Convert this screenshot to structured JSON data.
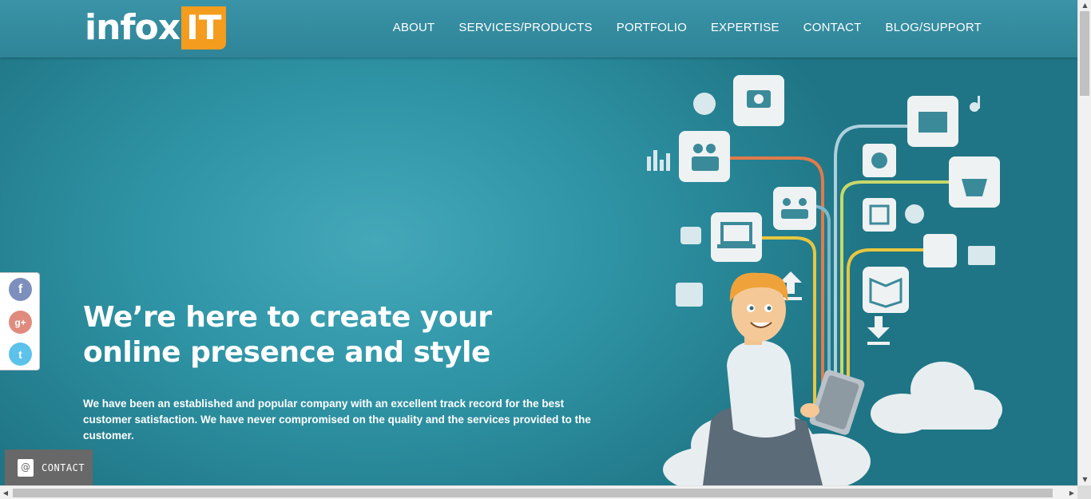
{
  "header": {
    "logo_text": "infox",
    "logo_highlight": "IT",
    "nav": [
      "ABOUT",
      "SERVICES/PRODUCTS",
      "PORTFOLIO",
      "EXPERTISE",
      "CONTACT",
      "BLOG/SUPPORT"
    ]
  },
  "hero": {
    "title": "We’re here to create your online presence and style",
    "subtitle": "We have been an established and popular company with an excellent track record for the best customer satisfaction. We have never compromised on the quality and the services provided to the customer."
  },
  "social": {
    "icons": [
      "facebook-icon",
      "google-plus-icon",
      "twitter-icon"
    ],
    "facebook_glyph": "f",
    "google_glyph": "g+",
    "twitter_glyph": "t"
  },
  "contact_tab": {
    "label": "CONTACT"
  },
  "colors": {
    "header": "#3a93a7",
    "hero_light": "#44a8b9",
    "hero_dark": "#1f7585",
    "accent_orange": "#f39c1e"
  }
}
